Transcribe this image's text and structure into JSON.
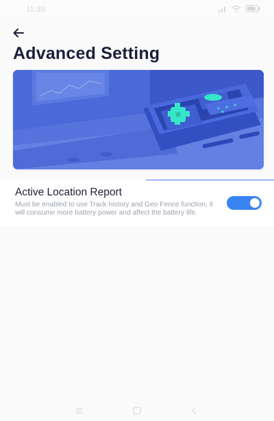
{
  "status_bar": {
    "time": "11:35",
    "icons": [
      "signal-icon",
      "wifi-icon",
      "battery-icon"
    ]
  },
  "header": {
    "back_icon": "arrow-left-icon",
    "title": "Advanced Setting"
  },
  "hero": {
    "illustration": "gps-tracker-device-illustration"
  },
  "settings": {
    "active_location_report": {
      "title": "Active Location Report",
      "description": "Must be enabled to use Track history and Geo Fence function, it will consume more battery power and affect the battery life.",
      "enabled": true
    }
  },
  "colors": {
    "accent": "#3a84f2",
    "title_text": "#1b1f3a",
    "secondary_text": "#9aa0ad",
    "hero_background": "#4664d8"
  },
  "nav_bar": {
    "buttons": [
      "nav-menu-icon",
      "nav-home-icon",
      "nav-back-icon"
    ]
  }
}
